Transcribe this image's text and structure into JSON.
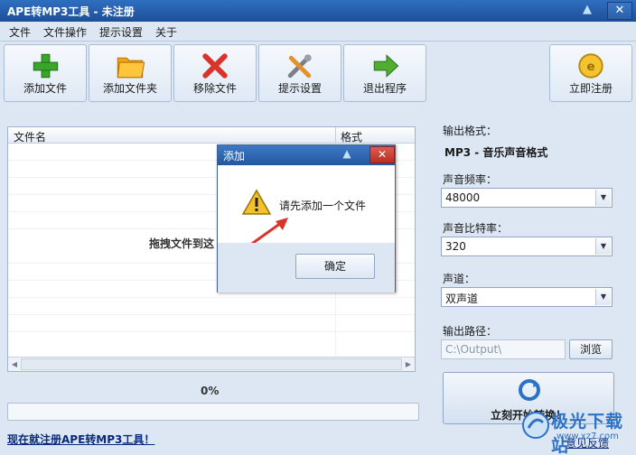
{
  "window": {
    "title": "APE转MP3工具 - 未注册"
  },
  "menu": [
    "文件",
    "文件操作",
    "提示设置",
    "关于"
  ],
  "toolbar": {
    "add_file": "添加文件",
    "add_folder": "添加文件夹",
    "remove_file": "移除文件",
    "prompt_settings": "提示设置",
    "exit": "退出程序",
    "register": "立即注册"
  },
  "file_list": {
    "columns": [
      "文件名",
      "格式"
    ],
    "drag_hint": "拖拽文件到这"
  },
  "progress": {
    "percent_text": "0%",
    "value": 0
  },
  "register_link": "现在就注册APE转MP3工具！",
  "settings": {
    "output_format_label": "输出格式：",
    "output_format_value": "MP3 - 音乐声音格式",
    "sample_rate_label": "声音频率：",
    "sample_rate_value": "48000",
    "bitrate_label": "声音比特率：",
    "bitrate_value": "320",
    "channel_label": "声道：",
    "channel_value": "双声道",
    "output_path_label": "输出路径：",
    "output_path_value": "C:\\Output\\",
    "browse_label": "浏览"
  },
  "convert_button": "立刻开始转换！",
  "feedback_link": "意见反馈",
  "dialog": {
    "title": "添加",
    "message": "请先添加一个文件",
    "ok_label": "确定"
  },
  "watermark": {
    "text": "极光下载站",
    "url": "www.xz7.com"
  },
  "colors": {
    "titlebar": "#2a62b0",
    "window_bg": "#dce7f3",
    "accent_red": "#d9342b",
    "link_blue": "#0a2a7a"
  },
  "icons": [
    "plus-icon",
    "folder-icon",
    "x-icon",
    "tools-icon",
    "arrow-right-icon",
    "coin-icon",
    "warning-icon",
    "convert-icon"
  ]
}
